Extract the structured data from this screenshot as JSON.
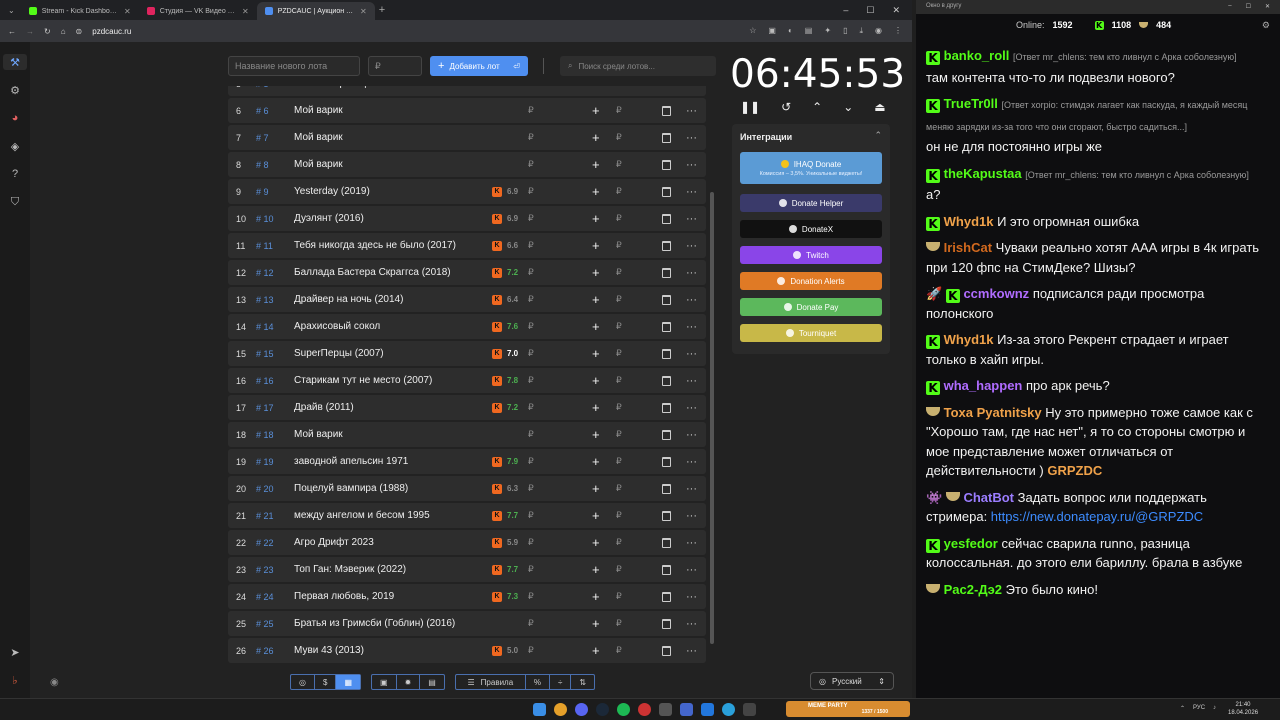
{
  "browser": {
    "tabs": [
      {
        "title": "Stream - Kick Dashboard",
        "color": "#53fc18"
      },
      {
        "title": "Студия — VK Видео Live",
        "color": "#e0245e"
      },
      {
        "title": "PZDCAUC | Аукцион для стри…",
        "color": "#4f8ff0"
      }
    ],
    "url": "pzdcauc.ru"
  },
  "toolbar": {
    "lot_placeholder": "Название нового лота",
    "price_placeholder": "₽",
    "add_label": "Добавить лот",
    "search_placeholder": "Поиск среди лотов..."
  },
  "lots": [
    {
      "idx": "6",
      "hash": "# 6",
      "name": "Мой варик",
      "rating": ""
    },
    {
      "idx": "7",
      "hash": "# 7",
      "name": "Мой варик",
      "rating": ""
    },
    {
      "idx": "8",
      "hash": "# 8",
      "name": "Мой варик",
      "rating": ""
    },
    {
      "idx": "9",
      "hash": "# 9",
      "name": "Yesterday (2019)",
      "rating": "6.9"
    },
    {
      "idx": "10",
      "hash": "# 10",
      "name": "Дуэлянт (2016)",
      "rating": "6.9"
    },
    {
      "idx": "11",
      "hash": "# 11",
      "name": " Тебя никогда здесь не было (2017)",
      "rating": "6.6"
    },
    {
      "idx": "12",
      "hash": "# 12",
      "name": "Баллада Бастера Скраггса (2018)",
      "rating": "7.2"
    },
    {
      "idx": "13",
      "hash": "# 13",
      "name": "Драйвер на ночь (2014)",
      "rating": "6.4"
    },
    {
      "idx": "14",
      "hash": "# 14",
      "name": "Арахисовый сокол",
      "rating": "7.6"
    },
    {
      "idx": "15",
      "hash": "# 15",
      "name": "SuperПерцы (2007)",
      "rating": "7.0"
    },
    {
      "idx": "16",
      "hash": "# 16",
      "name": "Старикам тут не место (2007)",
      "rating": "7.8"
    },
    {
      "idx": "17",
      "hash": "# 17",
      "name": "Драйв (2011)",
      "rating": "7.2"
    },
    {
      "idx": "18",
      "hash": "# 18",
      "name": "Мой варик",
      "rating": ""
    },
    {
      "idx": "19",
      "hash": "# 19",
      "name": "заводной апельсин 1971",
      "rating": "7.9"
    },
    {
      "idx": "20",
      "hash": "# 20",
      "name": "Поцелуй вампира (1988)",
      "rating": "6.3"
    },
    {
      "idx": "21",
      "hash": "# 21",
      "name": "между ангелом и бесом 1995",
      "rating": "7.7"
    },
    {
      "idx": "22",
      "hash": "# 22",
      "name": "Агро Дрифт 2023",
      "rating": "5.9"
    },
    {
      "idx": "23",
      "hash": "# 23",
      "name": " Топ Ган: Мэверик (2022)",
      "rating": "7.7"
    },
    {
      "idx": "24",
      "hash": "# 24",
      "name": "Первая любовь, 2019",
      "rating": "7.3"
    },
    {
      "idx": "25",
      "hash": "# 25",
      "name": "Братья из Гримсби (Гоблин) (2016)",
      "rating": ""
    },
    {
      "idx": "26",
      "hash": "# 26",
      "name": "Муви 43 (2013)",
      "rating": "5.0"
    }
  ],
  "rating_colors": {
    "high": "#4caf50",
    "mid": "#888888",
    "top": "#ffffff"
  },
  "timer": "06:45:53",
  "integrations": {
    "title": "Интеграции",
    "ihaq_label": "IHAQ Donate",
    "ihaq_sub": "Комиссия – 3,5%. Уникальные виджеты!",
    "items": [
      {
        "label": "Donate Helper",
        "color": "#3a3a6a"
      },
      {
        "label": "DonateX",
        "color": "#111111"
      },
      {
        "label": "Twitch",
        "color": "#8a45e8"
      },
      {
        "label": "Donation Alerts",
        "color": "#e07a25"
      },
      {
        "label": "Donate Pay",
        "color": "#5cb85c"
      },
      {
        "label": "Tourniquet",
        "color": "#c8b848"
      }
    ]
  },
  "bottom_bar": {
    "rules": "Правила"
  },
  "language": "Русский",
  "chat": {
    "header": "Окно в другу",
    "online_label": "Online:",
    "online": "1592",
    "kick_count": "1108",
    "other_count": "484",
    "messages": [
      {
        "user": "banko_roll",
        "color": "#53fc18",
        "badge": "kick",
        "reply": "[Ответ mr_chlens: тем кто ливнул с Арка соболезную]",
        "text": "там контента что-то ли подвезли нового?"
      },
      {
        "user": "TrueTr0ll",
        "color": "#53fc18",
        "badge": "kick",
        "reply": "[Ответ xorpio: стимдэк лагает как паскуда, я каждый месяц меняю зарядки из-за того что они сгорают, быстро садиться...]",
        "text": "он не для постоянно игры же"
      },
      {
        "user": "theKapustaa",
        "color": "#53fc18",
        "badge": "kick",
        "reply": "[Ответ mr_chlens: тем кто ливнул с Арка соболезную]",
        "text": "а?"
      },
      {
        "user": "Whyd1k",
        "color": "#f0a24a",
        "badge": "kick",
        "reply": "",
        "text": "И это огромная ошибка"
      },
      {
        "user": "IrishCat",
        "color": "#d2691e",
        "badge": "plate",
        "reply": "",
        "text": "Чуваки реально хотят ААА игры в 4к играть при 120 фпс на СтимДеке? Шизы?"
      },
      {
        "user": "ccmkownz",
        "color": "#b06cff",
        "badge": "kick2",
        "reply": "",
        "text": "подписался ради просмотра полонского"
      },
      {
        "user": "Whyd1k",
        "color": "#f0a24a",
        "badge": "kick",
        "reply": "",
        "text": "Из-за этого Рекрент страдает и играет только в хайп игры."
      },
      {
        "user": "wha_happen",
        "color": "#b06cff",
        "badge": "kick",
        "reply": "",
        "text": "про арк речь?"
      },
      {
        "user": "Toxa Pyatnitsky",
        "color": "#f0a24a",
        "badge": "plate",
        "reply": "",
        "text": "Ну это примерно тоже самое как с \"Хорошо там, где нас нет\", я то со стороны смотрю и мое представление может отличаться от действительности ) ",
        "tail": "GRPZDC"
      },
      {
        "user": "ChatBot",
        "color": "#9b7dff",
        "badge": "bot",
        "reply": "",
        "text": "Задать вопрос или поддержать стримера: ",
        "link": "https://new.donatepay.ru/@GRPZDC"
      },
      {
        "user": "yesfedor",
        "color": "#53fc18",
        "badge": "kick",
        "reply": "",
        "text": "сейчас сварила runno, разница колоссальная. до этого ели бариллу. брала в азбуке"
      },
      {
        "user": "Pac2-Дэ2",
        "color": "#53fc18",
        "badge": "plate",
        "reply": "",
        "text": "Это было кино!"
      }
    ]
  },
  "taskbar": {
    "meme_label": "MEME PARTY",
    "meme_sub": "1337 / 1500",
    "lang": "РУС",
    "time": "21:40",
    "date": "18.04.2026"
  }
}
